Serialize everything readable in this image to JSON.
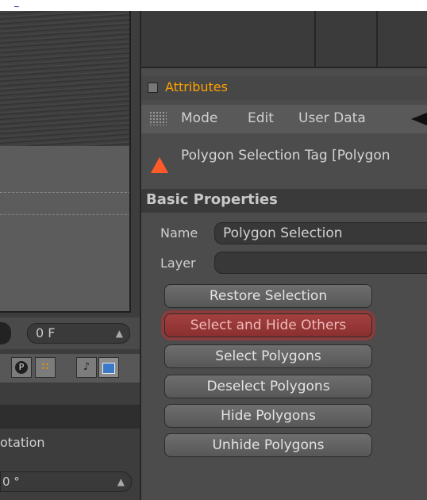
{
  "attributes_panel": {
    "title": "Attributes",
    "menu": [
      "Mode",
      "Edit",
      "User Data"
    ],
    "tag_title": "Polygon Selection Tag [Polygon",
    "section_header": "Basic Properties",
    "name_label": "Name",
    "name_value": "Polygon Selection",
    "layer_label": "Layer",
    "layer_value": "",
    "buttons": [
      {
        "label": "Restore Selection",
        "active": false
      },
      {
        "label": "Select and Hide Others",
        "active": true
      },
      {
        "label": "Select Polygons",
        "active": false
      },
      {
        "label": "Deselect Polygons",
        "active": false
      },
      {
        "label": "Hide Polygons",
        "active": false
      },
      {
        "label": "Unhide Polygons",
        "active": false
      }
    ]
  },
  "timeline": {
    "frame_value": "0 F"
  },
  "coordinates": {
    "rotation_label": "otation",
    "rotation_value": "0 °"
  },
  "toolbar_icons": [
    "playback-icon",
    "keyframe-grid-icon",
    "sound-icon",
    "layout-icon"
  ],
  "colors": {
    "attributes_title": "#ffa200",
    "tag_icon": "#ff5a2a",
    "active_button": "#a44040"
  }
}
